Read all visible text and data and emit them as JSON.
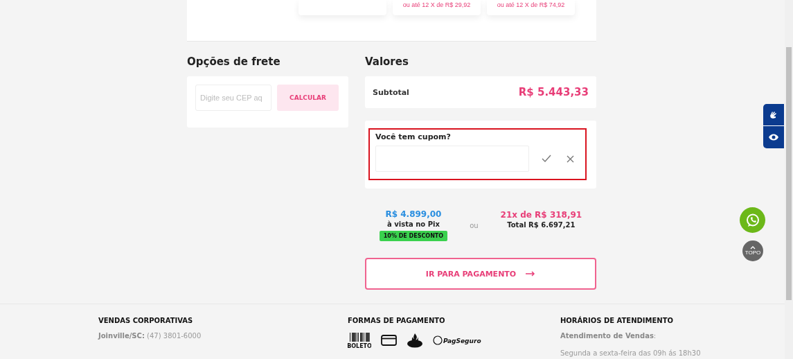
{
  "product_cards": [
    {
      "kind": "blank"
    },
    {
      "kind": "price",
      "installment": "ou até 12 X de R$ 29,92"
    },
    {
      "kind": "price",
      "installment": "ou até 12 X de R$ 74,92"
    }
  ],
  "shipping": {
    "title": "Opções de frete",
    "placeholder": "Digite seu CEP aq",
    "button": "CALCULAR"
  },
  "values": {
    "title": "Valores",
    "subtotal_label": "Subtotal",
    "subtotal": "R$ 5.443,33",
    "coupon": {
      "label": "Você tem cupom?",
      "highlighted": true
    },
    "pix": {
      "price": "R$ 4.899,00",
      "label": "à vista no Pix",
      "badge": "10% DE DESCONTO"
    },
    "or": "ou",
    "installments": {
      "price": "21x de R$ 318,91",
      "total": "Total R$ 6.697,21"
    },
    "pay_button": "IR PARA PAGAMENTO"
  },
  "floating": {
    "top_label": "TOPO"
  },
  "footer": {
    "columns": [
      {
        "kind": "text",
        "title": "VENDAS CORPORATIVAS",
        "lines": [
          "**Joinville/SC:** (47) 3801-6000"
        ]
      },
      {
        "kind": "payments",
        "title": "FORMAS DE PAGAMENTO",
        "boleto_label": "BOLETO",
        "pagseguro_label": "PagSeguro"
      },
      {
        "kind": "text",
        "title": "HORÁRIOS DE ATENDIMENTO",
        "lines": [
          "**Atendimento de Vendas**:",
          "Segunda a sexta-feira das 09h ás 18h30"
        ]
      }
    ]
  }
}
